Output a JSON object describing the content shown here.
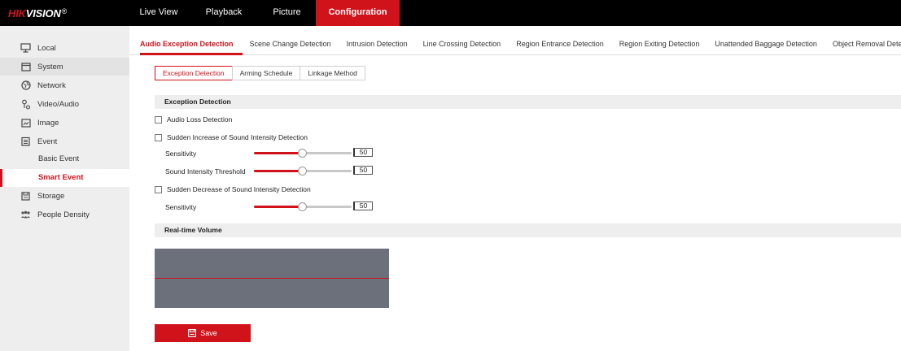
{
  "brand": {
    "logo_red": "HIK",
    "logo_white": "VISION",
    "logo_reg": "®"
  },
  "topnav": {
    "items": [
      "Live View",
      "Playback",
      "Picture",
      "Configuration"
    ],
    "active": "Configuration"
  },
  "sidebar": {
    "items": [
      {
        "label": "Local",
        "icon": "monitor-icon"
      },
      {
        "label": "System",
        "icon": "window-icon"
      },
      {
        "label": "Network",
        "icon": "globe-icon"
      },
      {
        "label": "Video/Audio",
        "icon": "video-audio-icon"
      },
      {
        "label": "Image",
        "icon": "image-icon"
      },
      {
        "label": "Event",
        "icon": "calendar-icon"
      },
      {
        "label": "Storage",
        "icon": "storage-icon"
      },
      {
        "label": "People Density",
        "icon": "people-icon"
      }
    ],
    "sub_items": [
      "Basic Event",
      "Smart Event"
    ],
    "active_sub": "Smart Event"
  },
  "tabs": {
    "items": [
      "Audio Exception Detection",
      "Scene Change Detection",
      "Intrusion Detection",
      "Line Crossing Detection",
      "Region Entrance Detection",
      "Region Exiting Detection",
      "Unattended Baggage Detection",
      "Object Removal Detection"
    ],
    "active": "Audio Exception Detection"
  },
  "steps": {
    "items": [
      "Exception Detection",
      "Arming Schedule",
      "Linkage Method"
    ],
    "active": "Exception Detection"
  },
  "exception": {
    "title": "Exception Detection",
    "audio_loss": "Audio Loss Detection",
    "sudden_increase": "Sudden Increase of Sound Intensity Detection",
    "increase_sensitivity_label": "Sensitivity",
    "increase_sensitivity_value": "50",
    "threshold_label": "Sound Intensity Threshold",
    "threshold_value": "50",
    "sudden_decrease": "Sudden Decrease of Sound Intensity Detection",
    "decrease_sensitivity_label": "Sensitivity",
    "decrease_sensitivity_value": "50"
  },
  "volume": {
    "title": "Real-time Volume"
  },
  "save_label": "Save",
  "colors": {
    "accent": "#d0121b",
    "topbar": "#000000",
    "sidebar": "#eeeeee",
    "volume_bg": "#6b707a"
  }
}
